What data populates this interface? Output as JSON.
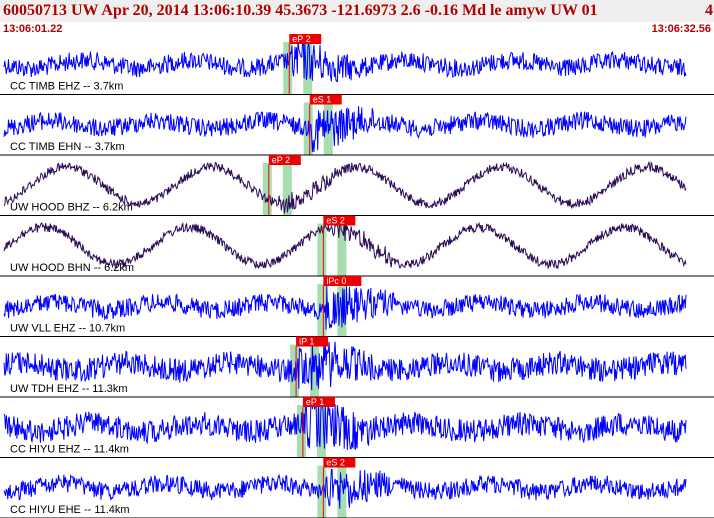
{
  "header": {
    "title": "60050713 UW Apr 20, 2014 13:06:10.39   45.3673 -121.6973  2.6 -0.16 Md le amyw UW 01",
    "title_right": "4",
    "time_start": "13:06:01.22",
    "time_end": "13:06:32.56"
  },
  "colors": {
    "title_text": "#b00000",
    "trace_blue": "#0000ff",
    "trace_purple": "#2a0a55",
    "pick_box": "#ee0000",
    "pick_line": "#ee0000",
    "window_band": "#a8ddb0",
    "divider": "#000000"
  },
  "chart_data": {
    "type": "seismogram",
    "time_range": [
      "13:06:01.22",
      "13:06:32.56"
    ],
    "traces": [
      {
        "label": "CC TIMB EHZ -- 3.7km",
        "pick": "eP 2",
        "color": "trace_blue",
        "style": "noise",
        "amp": 0.35,
        "arrival": 0.43
      },
      {
        "label": "CC TIMB EHN -- 3.7km",
        "pick": "eS 1",
        "color": "trace_blue",
        "style": "noise",
        "amp": 0.35,
        "arrival": 0.46
      },
      {
        "label": "UW HOOD BHZ -- 6.2km",
        "pick": "eP 2",
        "color": "trace_purple",
        "style": "sine",
        "amp": 0.7,
        "arrival": 0.4
      },
      {
        "label": "UW HOOD BHN -- 6.2km",
        "pick": "eS 2",
        "color": "trace_purple",
        "style": "sine",
        "amp": 0.7,
        "arrival": 0.48
      },
      {
        "label": "UW VLL EHZ -- 10.7km",
        "pick": "iPc 0",
        "color": "trace_blue",
        "style": "noise",
        "amp": 0.35,
        "arrival": 0.48
      },
      {
        "label": "UW TDH EHZ -- 11.3km",
        "pick": "iP 1",
        "color": "trace_blue",
        "style": "noise",
        "amp": 0.45,
        "arrival": 0.44
      },
      {
        "label": "CC HIYU EHZ -- 11.4km",
        "pick": "eP 1",
        "color": "trace_blue",
        "style": "noise",
        "amp": 0.45,
        "arrival": 0.45
      },
      {
        "label": "CC HIYU EHE -- 11.4km",
        "pick": "eS 2",
        "color": "trace_blue",
        "style": "noise",
        "amp": 0.35,
        "arrival": 0.48
      }
    ]
  }
}
